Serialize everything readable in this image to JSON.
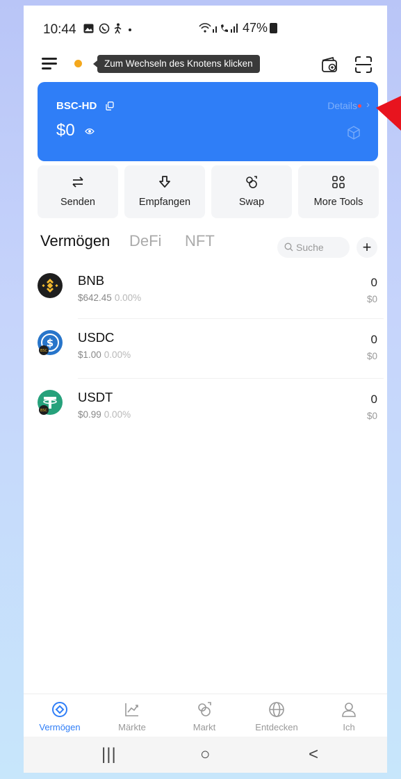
{
  "status_bar": {
    "time": "10:44",
    "notification_icons": [
      "gallery-icon",
      "whatsapp-icon",
      "walking-icon",
      "dot-icon"
    ],
    "signal": "wifi-signal-icon",
    "battery": "47%"
  },
  "header": {
    "menu_icon": "hamburger-icon",
    "node_status_color": "#f4a81d",
    "tooltip": "Zum Wechseln des Knotens klicken",
    "right_icons": [
      "wallet-add-icon",
      "scan-icon"
    ]
  },
  "wallet_card": {
    "name": "BSC-HD",
    "details_label": "Details",
    "balance": "$0",
    "background": "#2f7ef7"
  },
  "actions": [
    {
      "label": "Senden",
      "icon": "swap-arrows-icon"
    },
    {
      "label": "Empfangen",
      "icon": "receive-icon"
    },
    {
      "label": "Swap",
      "icon": "swap-circle-icon"
    },
    {
      "label": "More Tools",
      "icon": "grid-icon"
    }
  ],
  "tabs": {
    "items": [
      "Vermögen",
      "DeFi",
      "NFT"
    ],
    "active": "Vermögen",
    "search_placeholder": "Suche",
    "add_label": "+"
  },
  "tokens": [
    {
      "symbol": "BNB",
      "price": "$642.45",
      "change": "0.00%",
      "amount": "0",
      "value": "$0",
      "logo": "bnb-logo"
    },
    {
      "symbol": "USDC",
      "price": "$1.00",
      "change": "0.00%",
      "amount": "0",
      "value": "$0",
      "logo": "usdc-logo"
    },
    {
      "symbol": "USDT",
      "price": "$0.99",
      "change": "0.00%",
      "amount": "0",
      "value": "$0",
      "logo": "usdt-logo"
    }
  ],
  "bottom_nav": {
    "items": [
      "Vermögen",
      "Märkte",
      "Markt",
      "Entdecken",
      "Ich"
    ],
    "active": "Vermögen",
    "accent": "#2f7ef7"
  },
  "system_nav": {
    "recents": "|||",
    "home": "○",
    "back": "<"
  }
}
